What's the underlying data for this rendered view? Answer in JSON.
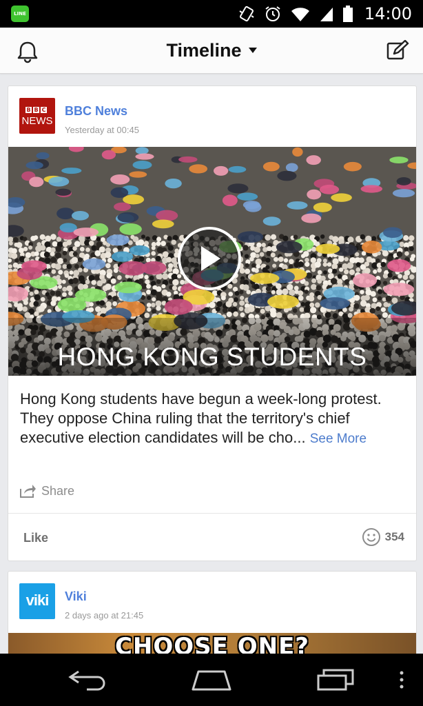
{
  "status_bar": {
    "app_badge": "LINE",
    "time": "14:00"
  },
  "header": {
    "title": "Timeline"
  },
  "posts": [
    {
      "author": "BBC News",
      "avatar_text": "NEWS",
      "avatar_boxes": [
        "B",
        "B",
        "C"
      ],
      "time": "Yesterday at 00:45",
      "media_caption": "HONG KONG STUDENTS",
      "text": "Hong Kong students have begun a week-long protest. They oppose China ruling that the territory's chief executive election candidates will be cho...",
      "see_more": "See More",
      "share_label": "Share",
      "like_label": "Like",
      "reaction_count": "354"
    },
    {
      "author": "Viki",
      "avatar_text": "viki",
      "time": "2 days ago at 21:45",
      "media_caption": "CHOOSE ONE?"
    }
  ],
  "colors": {
    "link_blue": "#4f80db",
    "bbc_red": "#b1150e",
    "viki_blue": "#1aa0e6",
    "line_green": "#3fc32f"
  }
}
